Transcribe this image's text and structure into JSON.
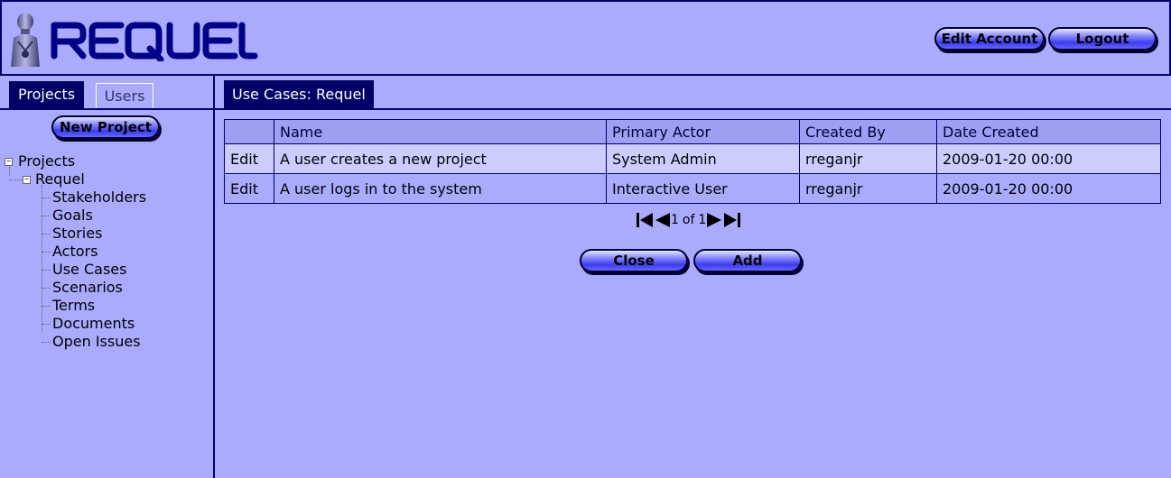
{
  "header": {
    "logo_text": "REQUEL",
    "edit_account_label": "Edit Account",
    "logout_label": "Logout"
  },
  "left_panel": {
    "tabs": [
      {
        "label": "Projects",
        "active": true
      },
      {
        "label": "Users",
        "active": false
      }
    ],
    "new_project_label": "New Project",
    "tree": {
      "root": "Projects",
      "project": "Requel",
      "children": [
        "Stakeholders",
        "Goals",
        "Stories",
        "Actors",
        "Use Cases",
        "Scenarios",
        "Terms",
        "Documents",
        "Open Issues"
      ]
    }
  },
  "main": {
    "tab_label": "Use Cases: Requel",
    "table": {
      "columns": [
        "",
        "Name",
        "Primary Actor",
        "Created By",
        "Date Created"
      ],
      "rows": [
        {
          "action": "Edit",
          "name": "A user creates a new project",
          "primary_actor": "System Admin",
          "created_by": "rreganjr",
          "date_created": "2009-01-20 00:00"
        },
        {
          "action": "Edit",
          "name": "A user logs in to the system",
          "primary_actor": "Interactive User",
          "created_by": "rreganjr",
          "date_created": "2009-01-20 00:00"
        }
      ]
    },
    "pager": {
      "current": "1",
      "of_label": "of",
      "total": "1"
    },
    "close_label": "Close",
    "add_label": "Add"
  },
  "colors": {
    "background": "#aaaaff",
    "accent": "#000066",
    "row_highlight": "#ccccff"
  }
}
